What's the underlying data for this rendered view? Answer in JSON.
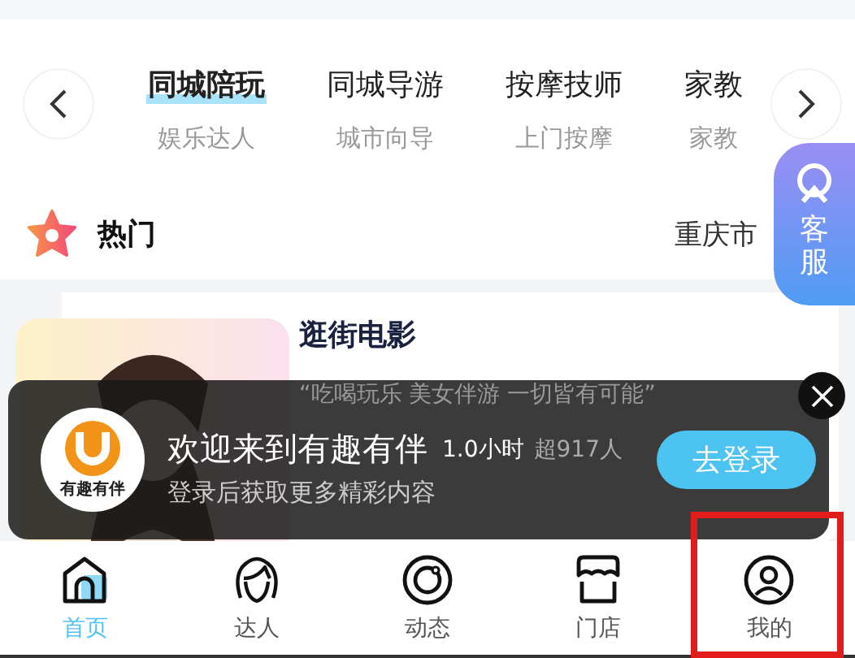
{
  "categories": [
    {
      "label": "同城陪玩",
      "subtitle": "娱乐达人",
      "selected": true
    },
    {
      "label": "同城导游",
      "subtitle": "城市向导",
      "selected": false
    },
    {
      "label": "按摩技师",
      "subtitle": "上门按摩",
      "selected": false
    },
    {
      "label": "家教",
      "subtitle": "家教",
      "selected": false
    }
  ],
  "service_button": {
    "label": "客服"
  },
  "section": {
    "title": "热门",
    "city": "重庆市"
  },
  "card": {
    "title": "逛街电影",
    "quote": "“吃喝玩乐 美女伴游 一切皆有可能”",
    "duration": "1.0小时",
    "sold": "超917人"
  },
  "login_banner": {
    "logo_text": "有趣有伴",
    "title": "欢迎来到有趣有伴",
    "subtitle": "登录后获取更多精彩内容",
    "button": "去登录"
  },
  "tabbar": [
    {
      "label": "首页",
      "selected": true
    },
    {
      "label": "达人",
      "selected": false
    },
    {
      "label": "动态",
      "selected": false
    },
    {
      "label": "门店",
      "selected": false
    },
    {
      "label": "我的",
      "selected": false,
      "highlighted": true
    }
  ]
}
